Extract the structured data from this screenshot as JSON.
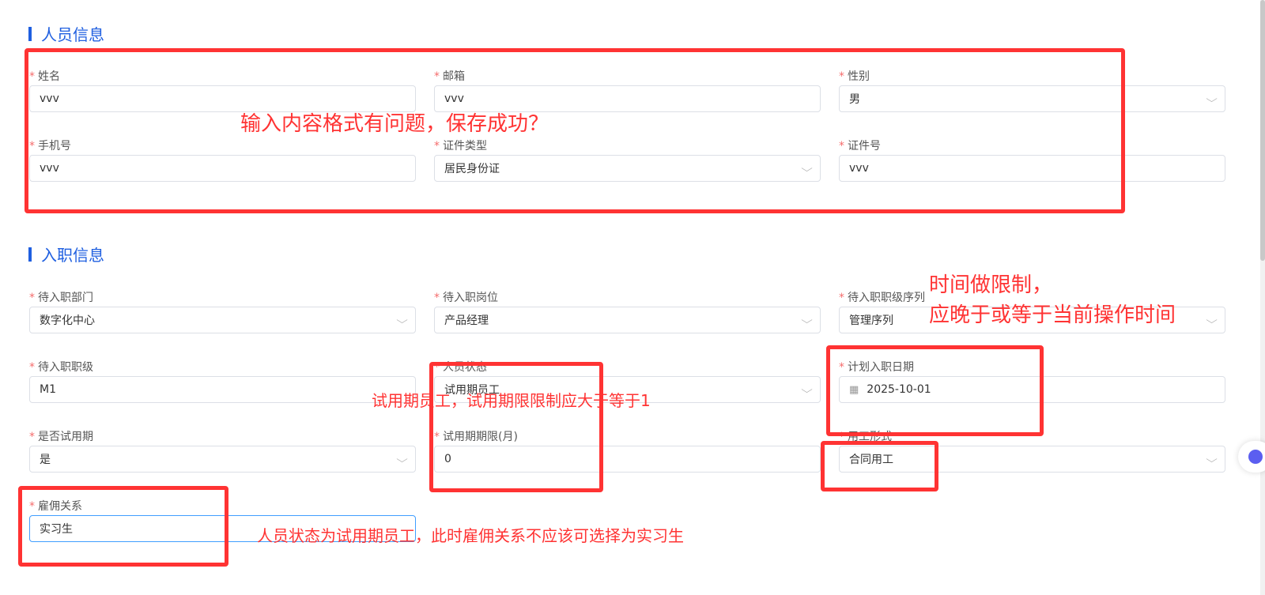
{
  "sections": {
    "personal": "人员信息",
    "onboarding": "入职信息"
  },
  "personal_fields": [
    {
      "label": "姓名",
      "value": "vvv",
      "type": "input"
    },
    {
      "label": "邮箱",
      "value": "vvv",
      "type": "input"
    },
    {
      "label": "性别",
      "value": "男",
      "type": "select"
    },
    {
      "label": "手机号",
      "value": "vvv",
      "type": "input"
    },
    {
      "label": "证件类型",
      "value": "居民身份证",
      "type": "select"
    },
    {
      "label": "证件号",
      "value": "vvv",
      "type": "input"
    }
  ],
  "onboarding_fields": [
    {
      "label": "待入职部门",
      "value": "数字化中心",
      "type": "select"
    },
    {
      "label": "待入职岗位",
      "value": "产品经理",
      "type": "select"
    },
    {
      "label": "待入职职级序列",
      "value": "管理序列",
      "type": "select"
    },
    {
      "label": "待入职职级",
      "value": "M1",
      "type": "input"
    },
    {
      "label": "人员状态",
      "value": "试用期员工",
      "type": "select"
    },
    {
      "label": "计划入职日期",
      "value": "2025-10-01",
      "type": "date"
    },
    {
      "label": "是否试用期",
      "value": "是",
      "type": "select"
    },
    {
      "label": "试用期期限(月)",
      "value": "0",
      "type": "input"
    },
    {
      "label": "用工形式",
      "value": "合同用工",
      "type": "select"
    },
    {
      "label": "雇佣关系",
      "value": "实习生",
      "type": "input"
    }
  ],
  "annotations": {
    "format": "输入内容格式有问题，保存成功？",
    "time_line1": "时间做限制，",
    "time_line2": "应晚于或等于当前操作时间",
    "probation": "试用期员工，试用期限限制应大于等于1",
    "employment": "人员状态为试用期员工，此时雇佣关系不应该可选择为实习生"
  },
  "required_mark": "*"
}
